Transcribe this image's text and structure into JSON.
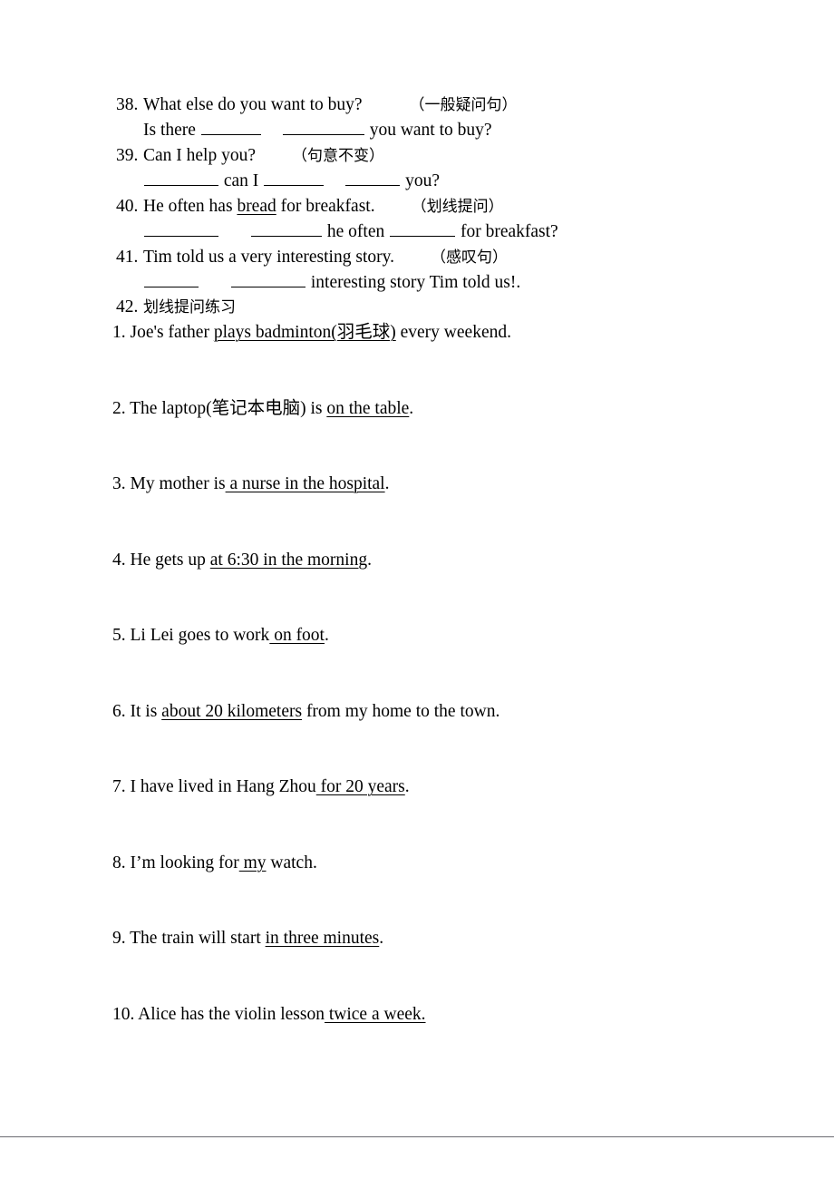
{
  "document": {
    "transform_exercises": [
      {
        "number": "38.",
        "sentence": "What else do you want to buy?",
        "note": "（一般疑问句）",
        "answer_prefix": "Is there",
        "answer_middle": "",
        "answer_suffix": "you want to buy?"
      },
      {
        "number": "39.",
        "sentence": "Can I help you?",
        "note": "（句意不变）",
        "answer_prefix": "",
        "answer_middle": "can I",
        "answer_suffix": "you?"
      },
      {
        "number": "40.",
        "sentence_pre": "He often has ",
        "sentence_underlined": "bread",
        "sentence_post": " for breakfast.",
        "note": "（划线提问）",
        "answer_middle": "he often",
        "answer_suffix": "for breakfast?"
      },
      {
        "number": "41.",
        "sentence": "Tim told us a very interesting story.",
        "note": "（感叹句）",
        "answer_suffix": "interesting story Tim told us!."
      }
    ],
    "section": {
      "number": "42.",
      "title": "划线提问练习"
    },
    "practice_items": [
      {
        "number": "1.",
        "pre": " Joe's father ",
        "underlined": "plays badminton(羽毛球)",
        "post": " every weekend."
      },
      {
        "number": "2.",
        "pre": " The laptop(笔记本电脑) is ",
        "underlined": "on the table",
        "post": "."
      },
      {
        "number": "3.",
        "pre": " My mother is",
        "underlined": " a nurse in the hospital",
        "post": "."
      },
      {
        "number": "4.",
        "pre": " He gets up ",
        "underlined": "at 6:30 in the morning",
        "post": "."
      },
      {
        "number": "5.",
        "pre": " Li Lei goes to work",
        "underlined": " on foot",
        "post": "."
      },
      {
        "number": "6.",
        "pre": " It is ",
        "underlined": "about 20 kilometers",
        "post": " from my home to the town."
      },
      {
        "number": "7.",
        "pre": " I have lived in Hang Zhou",
        "underlined": " for 20 years",
        "post": "."
      },
      {
        "number": "8.",
        "pre": " I’m looking for",
        "underlined": " my",
        "post": " watch."
      },
      {
        "number": "9.",
        "pre": " The train will start ",
        "underlined": "in three minutes",
        "post": "."
      },
      {
        "number": "10.",
        "pre": " Alice has the violin lesson",
        "underlined": " twice a week.",
        "post": ""
      }
    ]
  }
}
